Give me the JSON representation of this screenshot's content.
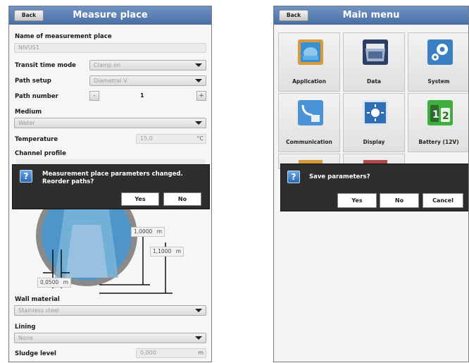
{
  "left": {
    "back_label": "Back",
    "title": "Measure place",
    "name_label": "Name of measurement place",
    "name_value": "NIVUS1",
    "path_time_mode_label": "Transit time mode",
    "path_time_mode_value": "Clamp on",
    "path_setup_label": "Path setup",
    "path_setup_value": "Diametral V",
    "path_number_label": "Path number",
    "path_number_minus": "-",
    "path_number_value": "1",
    "path_number_plus": "+",
    "medium_label": "Medium",
    "medium_value": "Water",
    "temperature_label": "Temperature",
    "temperature_value": "15,0",
    "temperature_unit": "°C",
    "channel_profile_label": "Channel profile",
    "dialog": {
      "icon": "?",
      "text": "Measurement place parameters changed. Reorder paths?",
      "yes_label": "Yes",
      "no_label": "No"
    },
    "dim_1_value": "1,0000",
    "dim_1_unit": "m",
    "dim_2_value": "1,1000",
    "dim_2_unit": "m",
    "dim_3_value": "0,0500",
    "dim_3_unit": "m",
    "wall_material_label": "Wall material",
    "wall_material_value": "Stainless steel",
    "lining_label": "Lining",
    "lining_value": "None",
    "sludge_level_label": "Sludge level",
    "sludge_level_value": "0,000",
    "sludge_level_unit": "m"
  },
  "right": {
    "back_label": "Back",
    "title": "Main menu",
    "tiles": [
      {
        "label": "Application",
        "icon": "application-icon",
        "color": "#3b8ed0"
      },
      {
        "label": "Data",
        "icon": "data-folder-icon",
        "color": "#2c3e63"
      },
      {
        "label": "System",
        "icon": "system-gears-icon",
        "color": "#3a7fc4"
      },
      {
        "label": "Communication",
        "icon": "communication-icon",
        "color": "#4a93d6"
      },
      {
        "label": "Display",
        "icon": "display-brightness-icon",
        "color": "#2f6fb3"
      },
      {
        "label": "Battery (12V)",
        "icon": "battery-icon",
        "color": "#3fae3f"
      }
    ],
    "dialog": {
      "icon": "?",
      "text": "Save parameters?",
      "yes_label": "Yes",
      "no_label": "No",
      "cancel_label": "Cancel"
    }
  },
  "colors": {
    "titlebar": "#5a7fb5",
    "dialog_bg": "#2e2e2e",
    "accent_blue": "#3b8ed0"
  }
}
